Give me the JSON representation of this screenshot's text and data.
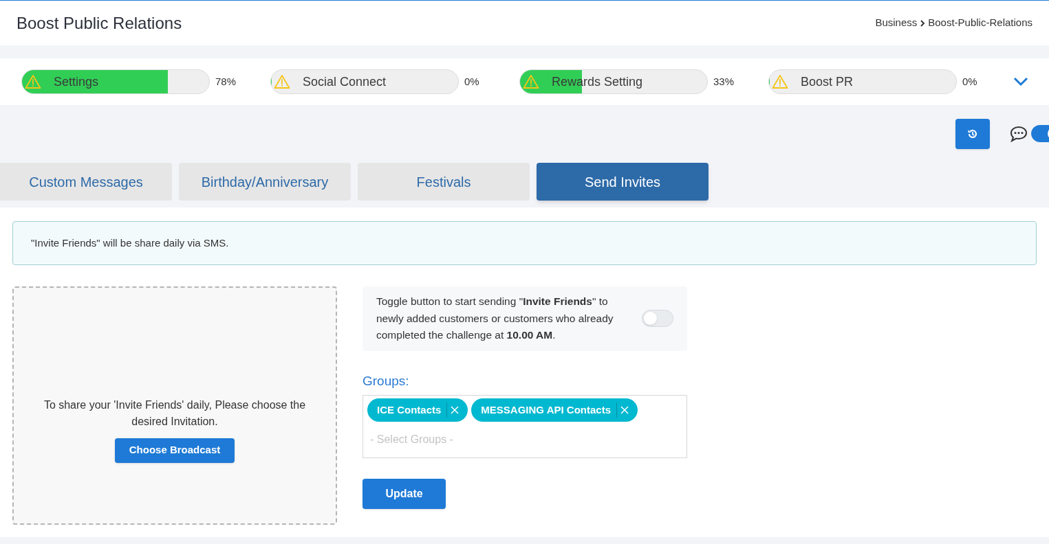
{
  "header": {
    "title": "Boost Public Relations",
    "breadcrumb": [
      "Business",
      "Boost-Public-Relations"
    ]
  },
  "progress": [
    {
      "label": "Settings",
      "level": 0.78,
      "reading": "78%"
    },
    {
      "label": "Social Connect",
      "level": 0,
      "reading": "0%"
    },
    {
      "label": "Rewards Setting",
      "level": 0.33,
      "reading": "33%"
    },
    {
      "label": "Boost PR",
      "level": 0,
      "reading": "0%"
    }
  ],
  "chat_toggle": {
    "on": true
  },
  "tabs": [
    {
      "label": "Custom Messages",
      "selected": false
    },
    {
      "label": "Birthday/Anniversary",
      "selected": false
    },
    {
      "label": "Festivals",
      "selected": false
    },
    {
      "label": "Send Invites",
      "selected": true
    }
  ],
  "notice": "\"Invite Friends\" will be share daily via SMS.",
  "invitation": {
    "text": "To share your 'Invite Friends' daily, Please choose the desired Invitation.",
    "button": "Choose Broadcast"
  },
  "auto_send": {
    "text": "Toggle button to start sending \"**Invite Friends**\" to newly added customers or customers who already completed the challenge at **10.00 AM**.",
    "on": false
  },
  "groups": {
    "label": "Groups:",
    "tags": [
      "ICE Contacts",
      "MESSAGING API Contacts"
    ],
    "placeholder": "- Select Groups -"
  },
  "update_button": "Update"
}
